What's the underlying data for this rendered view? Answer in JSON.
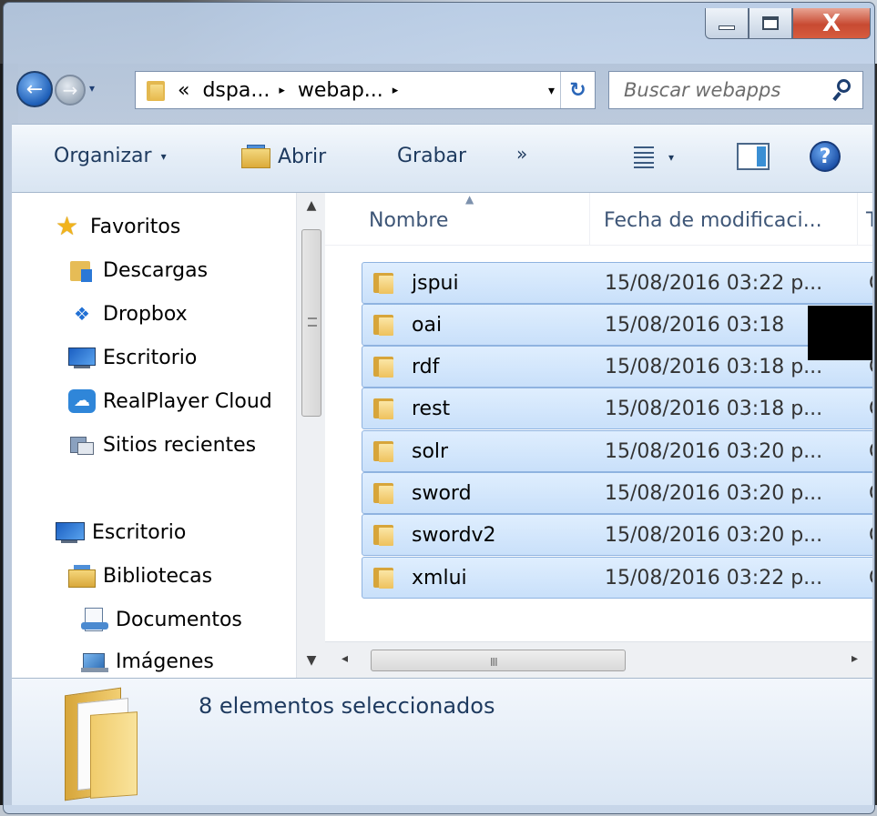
{
  "window": {
    "caption": {
      "minimize": "—",
      "maximize": "□",
      "close": "X"
    }
  },
  "navigation": {
    "back_glyph": "←",
    "forward_glyph": "→",
    "recent_glyph": "▾",
    "breadcrumb": {
      "overflow": "«",
      "items": [
        "dspa...",
        "webap..."
      ],
      "separator": "▸",
      "dropdown": "▾",
      "refresh_glyph": "↻"
    },
    "search": {
      "placeholder": "Buscar webapps",
      "icon": "search-icon"
    }
  },
  "toolbar": {
    "organize_label": "Organizar",
    "open_label": "Abrir",
    "burn_label": "Grabar",
    "more_label": "»",
    "dropdown_arrow": "▾",
    "help_glyph": "?"
  },
  "nav_pane": {
    "favorites_label": "Favoritos",
    "favorites": [
      "Descargas",
      "Dropbox",
      "Escritorio",
      "RealPlayer Cloud",
      "Sitios recientes"
    ],
    "desktop_label": "Escritorio",
    "libraries_label": "Bibliotecas",
    "libraries": [
      "Documentos",
      "Imágenes"
    ],
    "scroll_up": "▲",
    "scroll_down": "▼"
  },
  "file_list": {
    "columns": {
      "name": "Nombre",
      "date": "Fecha de modificaci...",
      "next": "T"
    },
    "rows": [
      {
        "name": "jspui",
        "date": "15/08/2016 03:22 p...",
        "next": "C"
      },
      {
        "name": "oai",
        "date": "15/08/2016 03:18",
        "next": ""
      },
      {
        "name": "rdf",
        "date": "15/08/2016 03:18 p...",
        "next": "C"
      },
      {
        "name": "rest",
        "date": "15/08/2016 03:18 p...",
        "next": "C"
      },
      {
        "name": "solr",
        "date": "15/08/2016 03:20 p...",
        "next": "C"
      },
      {
        "name": "sword",
        "date": "15/08/2016 03:20 p...",
        "next": "C"
      },
      {
        "name": "swordv2",
        "date": "15/08/2016 03:20 p...",
        "next": "C"
      },
      {
        "name": "xmlui",
        "date": "15/08/2016 03:22 p...",
        "next": "C"
      }
    ],
    "scroll_left": "◂",
    "scroll_right": "▸",
    "scroll_grip": "III"
  },
  "details": {
    "selection_text": "8 elementos seleccionados"
  },
  "colors": {
    "selection": "#cce4fb",
    "selection_border": "#8fb3e0",
    "toolbar_text": "#1e3a5f"
  }
}
